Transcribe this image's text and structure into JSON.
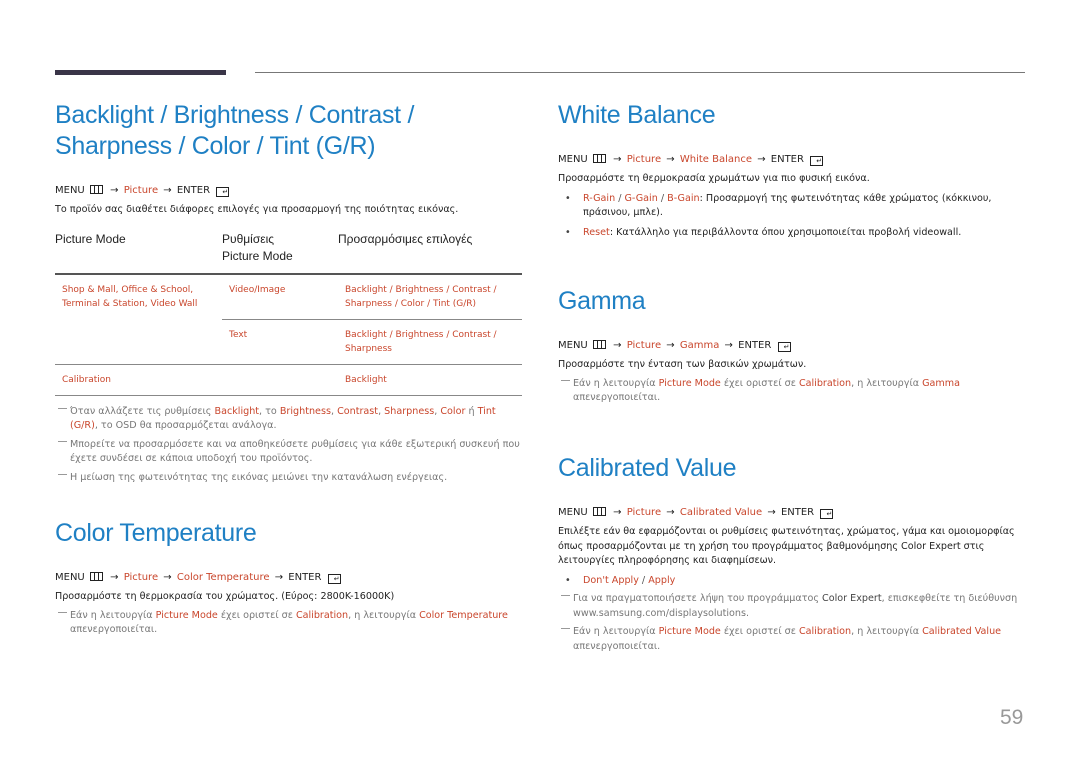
{
  "page_number": "59",
  "menu_labels": {
    "menu": "MENU",
    "enter": "ENTER",
    "arrow": "→"
  },
  "left": {
    "section1": {
      "title_line1": "Backlight / Brightness / Contrast /",
      "title_line2": "Sharpness / Color / Tint (G/R)",
      "path": [
        "Picture"
      ],
      "description": "Το προϊόν σας διαθέτει διάφορες επιλογές για προσαρμογή της ποιότητας εικόνας.",
      "table": {
        "headers": [
          "Picture Mode",
          "Ρυθμίσεις",
          "Picture Mode",
          "Προσαρμόσιμες επιλογές"
        ],
        "rows": [
          {
            "mode": "Shop & Mall, Office & School,",
            "mode2": "Terminal & Station, Video Wall",
            "setting": "Video/Image",
            "options1": "Backlight /  Brightness / Contrast /",
            "options2": "Sharpness / Color / Tint (G/R)"
          },
          {
            "mode": "",
            "mode2": "",
            "setting": "Text",
            "options1": "Backlight / Brightness / Contrast /",
            "options2": "Sharpness"
          },
          {
            "mode": "Calibration",
            "mode2": "",
            "setting": "",
            "options1": "Backlight",
            "options2": ""
          }
        ]
      },
      "notes": [
        {
          "p1": "Όταν αλλάζετε τις ρυθμίσεις ",
          "h1": "Backlight",
          "p2": ", το ",
          "h2": "Brightness",
          "p3": ", ",
          "h3": "Contrast",
          "p4": ", ",
          "h4": "Sharpness",
          "p5": ", ",
          "h5": "Color",
          "p6": " ή ",
          "h6": "Tint (G/R)",
          "p7": ", το OSD θα προσαρμόζεται ανάλογα."
        },
        {
          "text": "Μπορείτε να προσαρμόσετε και να αποθηκεύσετε ρυθμίσεις για κάθε εξωτερική συσκευή που έχετε συνδέσει σε κάποια υποδοχή του προϊόντος."
        },
        {
          "text": "Η μείωση της φωτεινότητας της εικόνας μειώνει την κατανάλωση ενέργειας."
        }
      ]
    },
    "section2": {
      "title": "Color Temperature",
      "path": [
        "Picture",
        "Color Temperature"
      ],
      "description": "Προσαρμόστε τη θερμοκρασία του χρώματος. (Εύρος: 2800K-16000K)",
      "note": {
        "p1": "Εάν η λειτουργία ",
        "h1": "Picture Mode",
        "p2": " έχει οριστεί σε ",
        "h2": "Calibration",
        "p3": ", η λειτουργία ",
        "h3": "Color Temperature",
        "p4": " απενεργοποιείται."
      }
    }
  },
  "right": {
    "white_balance": {
      "title": "White Balance",
      "path": [
        "Picture",
        "White Balance"
      ],
      "description": "Προσαρμόστε τη θερμοκρασία χρωμάτων για πιο φυσική εικόνα.",
      "bullets": [
        {
          "h1": "R-Gain",
          "s1": " / ",
          "h2": "G-Gain",
          "s2": " / ",
          "h3": "B-Gain",
          "text": ": Προσαρμογή της φωτεινότητας κάθε χρώματος (κόκκινου, πράσινου, μπλε)."
        },
        {
          "h1": "Reset",
          "text": ": Κατάλληλο για περιβάλλοντα όπου χρησιμοποιείται προβολή videowall."
        }
      ]
    },
    "gamma": {
      "title": "Gamma",
      "path": [
        "Picture",
        "Gamma"
      ],
      "description": "Προσαρμόστε την ένταση των βασικών χρωμάτων.",
      "note": {
        "p1": "Εάν η λειτουργία ",
        "h1": "Picture Mode",
        "p2": " έχει οριστεί σε ",
        "h2": "Calibration",
        "p3": ", η λειτουργία ",
        "h3": "Gamma",
        "p4": " απενεργοποιείται."
      }
    },
    "calibrated_value": {
      "title": "Calibrated Value",
      "path": [
        "Picture",
        "Calibrated Value"
      ],
      "description_p1": "Επιλέξτε εάν θα εφαρμόζονται οι ρυθμίσεις φωτεινότητας, χρώματος, γάμα και ομοιομορφίας όπως προσαρμόζονται με τη χρήση του προγράμματος βαθμονόμησης ",
      "description_b": "Color Expert",
      "description_p2": " στις λειτουργίες πληροφόρησης και διαφημίσεων.",
      "bullet": {
        "h1": "Don't Apply",
        "s1": " / ",
        "h2": "Apply"
      },
      "note1": {
        "p1": "Για να πραγματοποιήσετε λήψη του προγράμματος ",
        "b": "Color Expert",
        "p2": ", επισκεφθείτε τη διεύθυνση www.samsung.com/displaysolutions."
      },
      "note2": {
        "p1": "Εάν η λειτουργία ",
        "h1": "Picture Mode",
        "p2": " έχει οριστεί σε ",
        "h2": "Calibration",
        "p3": ", η λειτουργία ",
        "h3": "Calibrated Value",
        "p4": " απενεργοποιείται."
      }
    }
  },
  "colors": {
    "heading": "#1f80c4",
    "highlight": "#c9462c",
    "note": "#777777"
  }
}
